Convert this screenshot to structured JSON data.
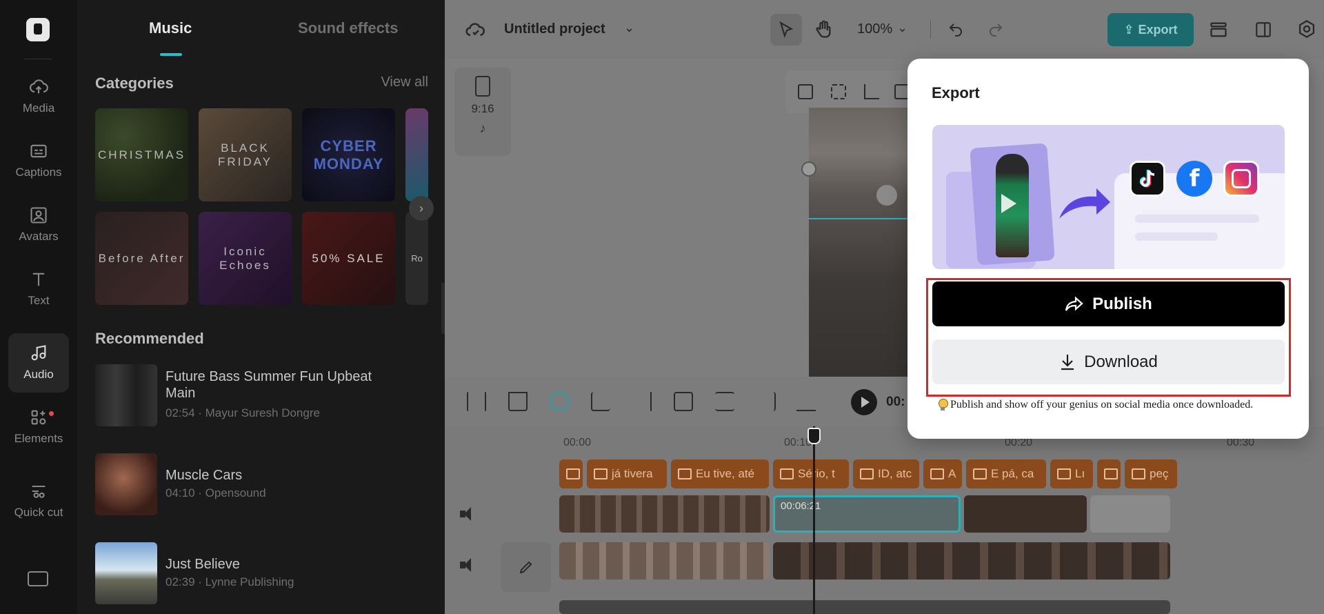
{
  "sidebar": {
    "items": [
      {
        "label": "Media",
        "icon": "cloud-upload-icon"
      },
      {
        "label": "Captions",
        "icon": "captions-icon"
      },
      {
        "label": "Avatars",
        "icon": "avatar-icon"
      },
      {
        "label": "Text",
        "icon": "text-icon"
      },
      {
        "label": "Audio",
        "icon": "music-note-icon",
        "active": true
      },
      {
        "label": "Elements",
        "icon": "elements-icon",
        "badge": true
      },
      {
        "label": "Quick cut",
        "icon": "quick-cut-icon"
      }
    ]
  },
  "panel": {
    "tabs": [
      "Music",
      "Sound effects"
    ],
    "categories_title": "Categories",
    "view_all": "View all",
    "categories": [
      {
        "label": "CHRISTMAS"
      },
      {
        "label": "BLACK FRIDAY"
      },
      {
        "label": "CYBER MONDAY"
      },
      {
        "label": ""
      },
      {
        "label": "Before After"
      },
      {
        "label": "Iconic Echoes"
      },
      {
        "label": "50% SALE"
      },
      {
        "label": "Ro"
      }
    ],
    "recommended_title": "Recommended",
    "tracks": [
      {
        "title": "Future Bass Summer Fun Upbeat Main",
        "meta": "02:54 · Mayur Suresh Dongre"
      },
      {
        "title": "Muscle Cars",
        "meta": "04:10 · Opensound"
      },
      {
        "title": "Just Believe",
        "meta": "02:39 · Lynne Publishing"
      }
    ]
  },
  "header": {
    "project_title": "Untitled project",
    "zoom": "100%",
    "export_label": "Export"
  },
  "canvas": {
    "ratio": "9:16"
  },
  "timeline": {
    "current_time": "00:",
    "ruler": [
      "00:00",
      "00:10",
      "00:20",
      "00:30"
    ],
    "captions": [
      "",
      "já tivera",
      "Eu tive, até",
      "Sério, t",
      "ID, atc",
      "A",
      "E pá, ca",
      "Lı",
      "",
      "peç"
    ],
    "clip_time": "00:06:21"
  },
  "export_dialog": {
    "title": "Export",
    "publish_label": "Publish",
    "download_label": "Download",
    "tip": "Publish and show off your genius on social media once downloaded."
  },
  "colors": {
    "accent": "#21c2cc",
    "highlight": "#e02424",
    "caption": "#8a4a1c"
  }
}
